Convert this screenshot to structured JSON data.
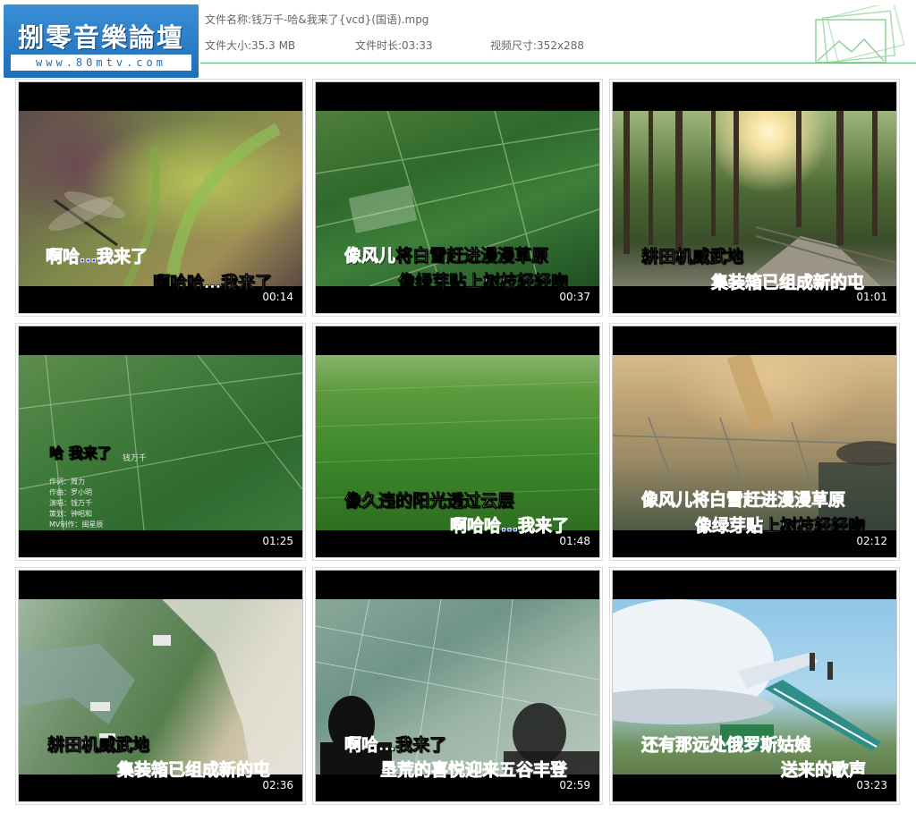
{
  "logo": {
    "name": "捌零音樂論壇",
    "url": "www.80mtv.com"
  },
  "file": {
    "name_label": "文件名称:",
    "name_value": "钱万千-哈&我来了{vcd}(国语).mpg",
    "size_label": "文件大小:",
    "size_value": "35.3 MB",
    "duration_label": "文件时长:",
    "duration_value": "03:33",
    "dims_label": "视频尺寸:",
    "dims_value": "352x288"
  },
  "thumbs": [
    {
      "time": "00:14",
      "line1": "啊哈…我来了",
      "line2": "啊哈哈…我来了"
    },
    {
      "time": "00:37",
      "line1_a": "像风儿",
      "line1_b": "将白雪赶进漫漫草原",
      "line2": "像绿芽贴上树枝轻轻吻"
    },
    {
      "time": "01:01",
      "line1": "耕田机威武地",
      "line2": "集装箱已组成新的屯"
    },
    {
      "time": "01:25",
      "title": "哈 我来了",
      "singer": "钱万千",
      "credits": "作词：周力\n作曲：罗小明\n演唱：钱万千\n策划：钟昭和\nMV制作：闽星辰"
    },
    {
      "time": "01:48",
      "line1": "像久违的阳光透过云层",
      "line2": "啊哈哈…我来了"
    },
    {
      "time": "02:12",
      "line1": "像风儿将白雪赶进漫漫草原",
      "line2_a": "像绿芽贴",
      "line2_b": "上树枝轻轻吻"
    },
    {
      "time": "02:36",
      "line1": "耕田机威武地",
      "line2": "集装箱已组成新的屯"
    },
    {
      "time": "02:59",
      "line1_a": "啊哈",
      "line1_b": "…我来了",
      "line2": "垦荒的喜悦迎来五谷丰登"
    },
    {
      "time": "03:23",
      "line1": "还有那远处俄罗斯姑娘",
      "line2": "送来的歌声"
    }
  ],
  "colors": {
    "lyric_blue": "#3b47ff",
    "accent_green": "#55b36a",
    "logo_blue": "#1f6fb8"
  }
}
